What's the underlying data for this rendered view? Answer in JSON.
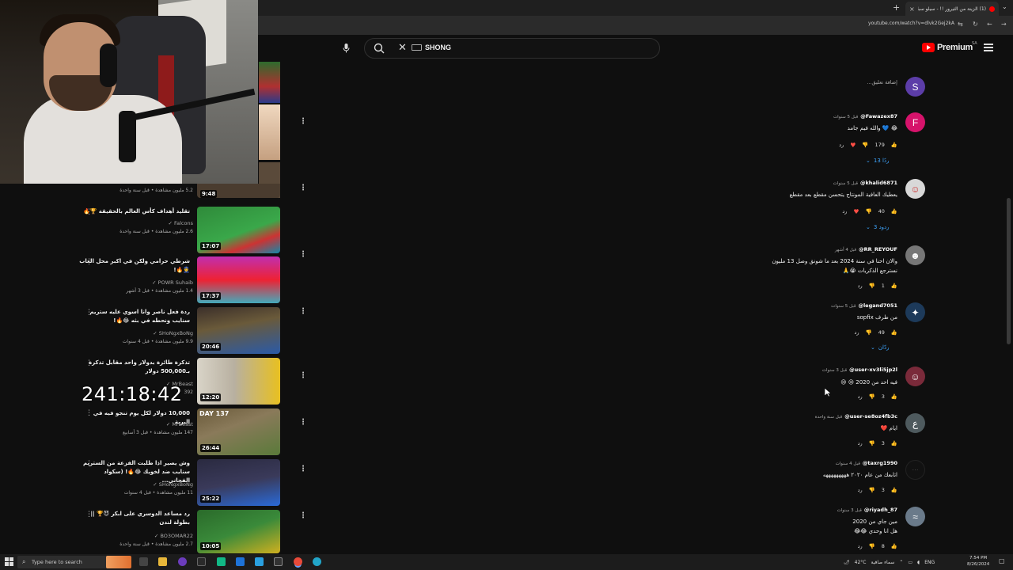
{
  "browser": {
    "tab_title": "(1) الزينة من الثيرور !! - سيلو سبك",
    "url": "youtube.com/watch?v=dlvk2Gej2kA",
    "new_tab": "+",
    "tab_close": "×"
  },
  "youtube": {
    "search_value": "SHONG",
    "logo_text": "Premium",
    "region": "SA"
  },
  "overlay": {
    "timer": "241:18:42"
  },
  "sidebar": {
    "items": [
      {
        "title": "",
        "channel": "",
        "meta": "5.2 مليون مشاهدة • قبل سنة واحدة",
        "duration": "9:48"
      },
      {
        "title": "تقليد أهداف كأس العالم بالحقيقة 🏆🔥",
        "channel": "Falcons",
        "meta": "2.6 مليون مشاهدة • قبل سنة واحدة",
        "duration": "17:07"
      },
      {
        "title": "شرطي حرامي ولكن في اكبر محل العاب 👮🔥!",
        "channel": "POWR Suhaib",
        "meta": "1.4 مليون مشاهدة • قبل 3 أشهر",
        "duration": "17:37"
      },
      {
        "title": "ردة فعل ناصر وانا اسوي عليه ستريم سنايب ونحطه في بثه 😂🔥!",
        "channel": "SHoNgxBoNg",
        "meta": "9.9 مليون مشاهدة • قبل 4 سنوات",
        "duration": "20:46"
      },
      {
        "title": "تذكرة طائرة بدولار واحد مقابل تذكرة بـ500,000 دولار",
        "channel": "MrBeast",
        "meta": "392",
        "duration": "12:20"
      },
      {
        "title": "10,000 دولار لكل يوم تنجو فيه في البرية",
        "channel": "MrBeast",
        "meta": "147 مليون مشاهدة • قبل 3 أسابيع",
        "duration": "26:44"
      },
      {
        "title": "وش يصير اذا طلبت الفزعة من الستريم سنايب ضد لخويك 😂🔥! (سكواد الفجاني...",
        "channel": "SHoNgxBoNg",
        "meta": "11 مليون مشاهدة • قبل 4 سنوات",
        "duration": "25:22"
      },
      {
        "title": "رد مساعد الدوسري على ابكر 😈🏆 || بطولة لندن",
        "channel": "BO3OMAR22",
        "meta": "2.7 مليون مشاهدة • قبل سنة واحدة",
        "duration": "10:05"
      }
    ]
  },
  "comments": {
    "add_placeholder": "إضافة تعليق...",
    "my_avatar": "S",
    "list": [
      {
        "author": "@Fawazex87",
        "time": "قبل 5 سنوات",
        "text": "😂 💙 والله فيم جامد",
        "likes": "179",
        "avatar": "F",
        "replies": "13 ردًا"
      },
      {
        "author": "@khalid6871",
        "time": "قبل 5 سنوات",
        "text": "يعطيك العافية المونتاج يتحسن مقطع بعد مقطع",
        "likes": "40",
        "avatar": "",
        "replies": "3 ردود"
      },
      {
        "author": "@RR_REYOUF",
        "time": "قبل 4 أشهر",
        "text": "والان احنا في سنة 2024 بعد ما شونق وصل 13 مليون",
        "text2": "نسترجع الذكريات 😭🙏",
        "likes": "1",
        "avatar": ""
      },
      {
        "author": "@legand7051",
        "time": "قبل 5 سنوات",
        "text": "من طرف sopfix",
        "likes": "49",
        "avatar": "",
        "replies": "ردّان"
      },
      {
        "author": "@user-xv3li5jp2l",
        "time": "قبل 3 سنوات",
        "text": "فيه احد من 2020 😢 😢",
        "likes": "3",
        "avatar": ""
      },
      {
        "author": "@user-se8oz4fb3c",
        "time": "قبل سنة واحدة",
        "text": "ايام ❤️",
        "likes": "3",
        "avatar": "ع"
      },
      {
        "author": "@taxrg1990",
        "time": "قبل 4 سنوات",
        "text": "اتابعك من عام ٢٠٢٠ هههههههههه",
        "likes": "3",
        "avatar": ""
      },
      {
        "author": "@riyadh_87",
        "time": "قبل 3 سنوات",
        "text": "مين جاي من 2020",
        "text2": "هل انا وحدي 😂😂",
        "likes": "8",
        "avatar": ""
      }
    ],
    "reply_label": "رد"
  },
  "taskbar": {
    "search_placeholder": "Type here to search",
    "weather": "42°C",
    "weather_desc": "سماء صافية",
    "lang": "ENG",
    "time": "7:54 PM",
    "date": "8/26/2024"
  },
  "colors": {
    "bg": "#0f0f0f",
    "accent": "#ff0000",
    "link": "#3ea6ff"
  }
}
